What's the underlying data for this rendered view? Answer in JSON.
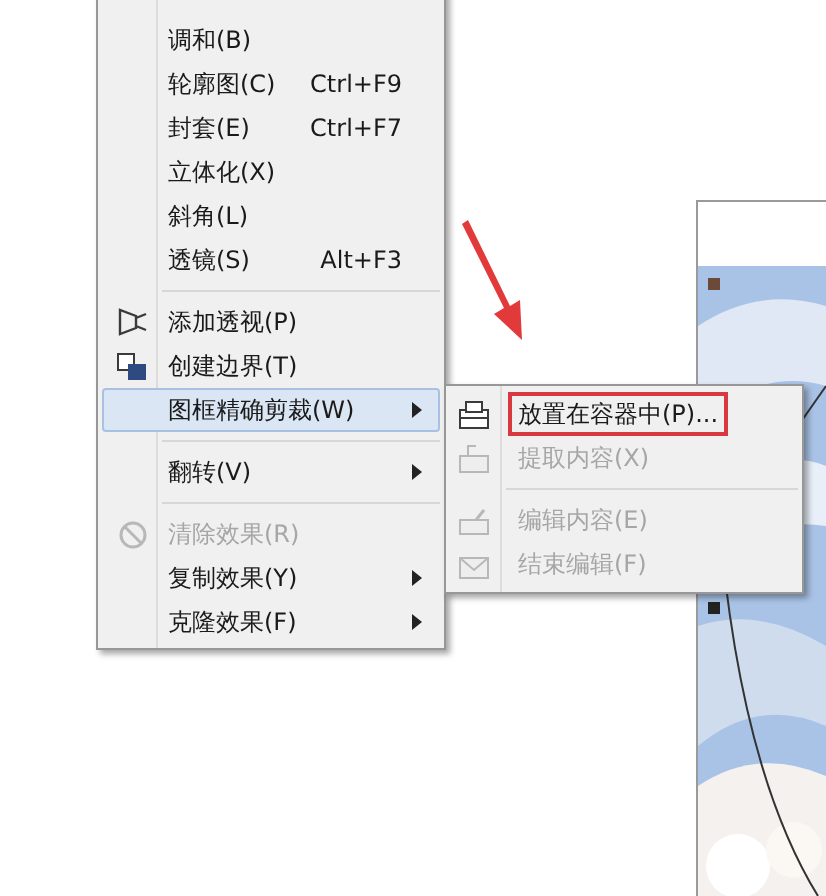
{
  "menu": {
    "items": [
      {
        "kind": "item",
        "label": "调和(B)",
        "disabled": false,
        "selected": false,
        "submenu": false
      },
      {
        "kind": "item",
        "label": "轮廓图(C)",
        "shortcut": "Ctrl+F9",
        "disabled": false,
        "selected": false,
        "submenu": false
      },
      {
        "kind": "item",
        "label": "封套(E)",
        "shortcut": "Ctrl+F7",
        "disabled": false,
        "selected": false,
        "submenu": false
      },
      {
        "kind": "item",
        "label": "立体化(X)",
        "disabled": false,
        "selected": false,
        "submenu": false
      },
      {
        "kind": "item",
        "label": "斜角(L)",
        "disabled": false,
        "selected": false,
        "submenu": false
      },
      {
        "kind": "item",
        "label": "透镜(S)",
        "shortcut": "Alt+F3",
        "disabled": false,
        "selected": false,
        "submenu": false
      },
      {
        "kind": "separator"
      },
      {
        "kind": "item",
        "label": "添加透视(P)",
        "disabled": false,
        "selected": false,
        "submenu": false
      },
      {
        "kind": "item",
        "label": "创建边界(T)",
        "disabled": false,
        "selected": false,
        "submenu": false
      },
      {
        "kind": "item",
        "label": "图框精确剪裁(W)",
        "disabled": false,
        "selected": true,
        "submenu": true
      },
      {
        "kind": "separator"
      },
      {
        "kind": "item",
        "label": "翻转(V)",
        "disabled": false,
        "selected": false,
        "submenu": true
      },
      {
        "kind": "separator"
      },
      {
        "kind": "item",
        "label": "清除效果(R)",
        "disabled": true,
        "selected": false,
        "submenu": false
      },
      {
        "kind": "item",
        "label": "复制效果(Y)",
        "disabled": false,
        "selected": false,
        "submenu": true
      },
      {
        "kind": "item",
        "label": "克隆效果(F)",
        "disabled": false,
        "selected": false,
        "submenu": true
      }
    ]
  },
  "submenu": {
    "items": [
      {
        "kind": "item",
        "label": "放置在容器中(P)...",
        "disabled": false,
        "highlighted": true
      },
      {
        "kind": "item",
        "label": "提取内容(X)",
        "disabled": true,
        "highlighted": false
      },
      {
        "kind": "separator"
      },
      {
        "kind": "item",
        "label": "编辑内容(E)",
        "disabled": true,
        "highlighted": false
      },
      {
        "kind": "item",
        "label": "结束编辑(F)",
        "disabled": true,
        "highlighted": false
      }
    ]
  }
}
